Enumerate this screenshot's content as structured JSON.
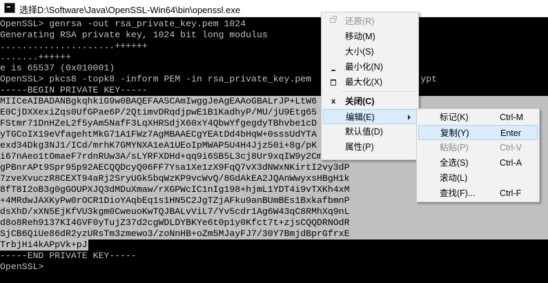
{
  "window": {
    "title": "选择D:\\Software\\Java\\OpenSSL-Win64\\bin\\openssl.exe"
  },
  "console": {
    "lines": [
      "OpenSSL> genrsa -out rsa_private_key.pem 1024",
      "Generating RSA private key, 1024 bit long modulus",
      ".....................++++++",
      ".......++++++",
      "e is 65537 (0x010001)",
      "OpenSSL> pkcs8 -topk8 -inform PEM -in rsa_private_key.pem                    ypt",
      "-----BEGIN PRIVATE KEY-----",
      "MIICeAIBADANBgkqhkiG9w0BAQEFAASCAmIwggJeAgEAAoGBALrJP+LtW6",
      "E0CjDXXexiZqs0UfGPae6P/2QtimvDRqdjpwE1B1KadhyP/MU/jU9Etg65",
      "FStmr71DnHZeL2f5yAm5NafF3LqXHRSdjX60xY4QbwYfgegdyTBhvbe1cD",
      "yTGCoIX19eVfagehtMkG71A1FWz7AgMBAAECgYEAtDd4bHqW+0sssUdYTA",
      "exd34Dkg3NJ1/ICd/mrhK7GMYNXA1eA1UEoIpMWAP5U4H4Jjz50i+8g/pK",
      "i67nAeo1tOmaeF7rdnRUw3A/sLYRFXDHd+qq9i6SB5L3cj8Ur9xqIW9y2CmmIym",
      "gPBnrAPt9Spr95p92AECQQDcyQ06FF7Ysa1Xe1zX9FqQ7vX3dNWxNKirtI2vy3dP",
      "7zveXvuczR8CEXT94aRj2SryUGk5bqWzKP9vcWvQ/8GdAkEA2JQAnWwyxsHBgH1k",
      "8fT8I2oB3g0gGOUPXJQ3dMDuXmaw/rXGPWcIC1nIg198+hjmL1YDT4i9vTXKh4xM",
      "+4MRdwJAXKyPw0rOCR1DioYAqbEq1s1HN5C2JgTZjAFku9anBUmBEs1BxkafbmnP",
      "dsXhD/xXN5EjKfVU3kgm0CweuoKwTQJBALvViL7/Yv5cdr1Ag6W43qC8RMhXq9nL",
      "d8o8Reh9137KI4GVF0yTujZ37d2cgWDLDYBKYe6t0p1y0Kfct7t+zjsCQQDRNOdR",
      "SjCB6QiUe86dR2yzURsTm3zmewo3/zoNnHB+oZm5MJayFJ7/30Y7BmjdBprGfrxE",
      "TrbjHi4kAPpVk+pJ",
      "-----END PRIVATE KEY-----",
      "OpenSSL>"
    ]
  },
  "system_menu": {
    "items": [
      {
        "label": "还原(R)",
        "icon": "restore-icon"
      },
      {
        "label": "移动(M)"
      },
      {
        "label": "大小(S)"
      },
      {
        "label": "最小化(N)",
        "icon": "minimize-icon"
      },
      {
        "label": "最大化(X)",
        "icon": "maximize-icon"
      },
      {
        "label": "关闭(C)",
        "icon": "close-icon"
      },
      {
        "label": "编辑(E)"
      },
      {
        "label": "默认值(D)"
      },
      {
        "label": "属性(P)"
      }
    ],
    "close_glyph": "x"
  },
  "edit_menu": {
    "items": [
      {
        "label": "标记(K)",
        "shortcut": "Ctrl-M"
      },
      {
        "label": "复制(Y)",
        "shortcut": "Enter"
      },
      {
        "label": "粘贴(P)",
        "shortcut": "Ctrl-V"
      },
      {
        "label": "全选(S)",
        "shortcut": "Ctrl-A"
      },
      {
        "label": "滚动(L)",
        "shortcut": ""
      },
      {
        "label": "查找(F)...",
        "shortcut": "Ctrl-F"
      }
    ]
  },
  "colors": {
    "console_bg": "#000000",
    "console_fg": "#c0c0c0",
    "selection_bg": "#c0c0c0",
    "menu_bg": "#f2f2f2",
    "menu_highlight": "#d9ecfb"
  }
}
